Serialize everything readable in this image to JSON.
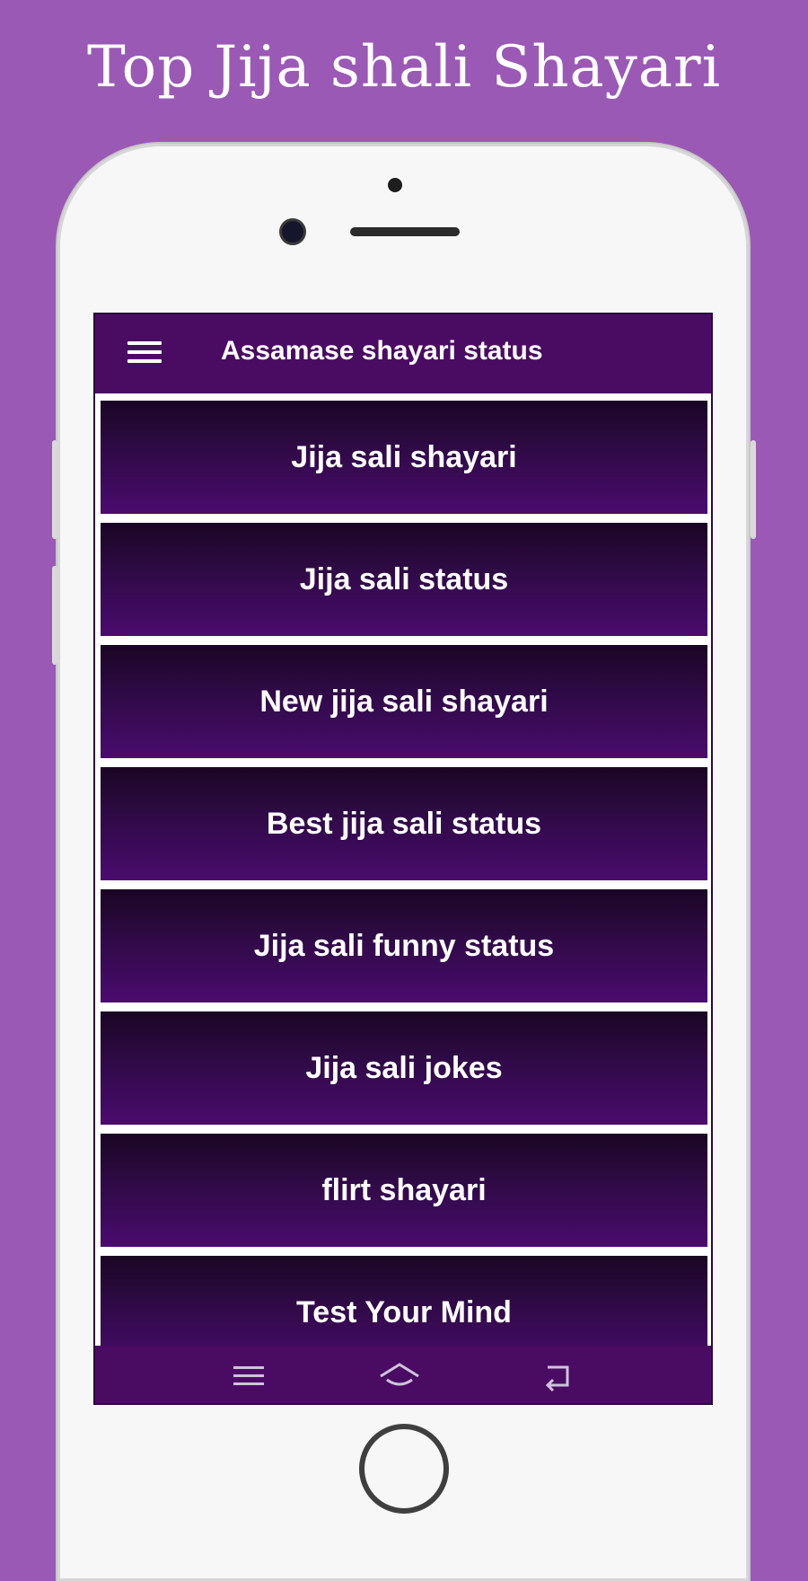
{
  "promo": {
    "title": "Top Jija shali Shayari"
  },
  "app_bar": {
    "title": "Assamase shayari status",
    "menu_icon": "hamburger-menu-icon"
  },
  "list": {
    "items": [
      {
        "label": "Jija sali shayari"
      },
      {
        "label": "Jija sali status"
      },
      {
        "label": "New jija sali shayari"
      },
      {
        "label": "Best jija sali status"
      },
      {
        "label": "Jija sali funny status"
      },
      {
        "label": "Jija sali jokes"
      },
      {
        "label": "flirt shayari"
      },
      {
        "label": "Test Your Mind"
      }
    ]
  },
  "nav_bar": {
    "icons": [
      "recent-apps-icon",
      "home-icon",
      "back-icon"
    ]
  },
  "colors": {
    "background": "#9b59b6",
    "app_bar": "#4a0b63",
    "item_top": "#1a0624",
    "item_bottom": "#4a0b6e",
    "text": "#ffffff"
  }
}
